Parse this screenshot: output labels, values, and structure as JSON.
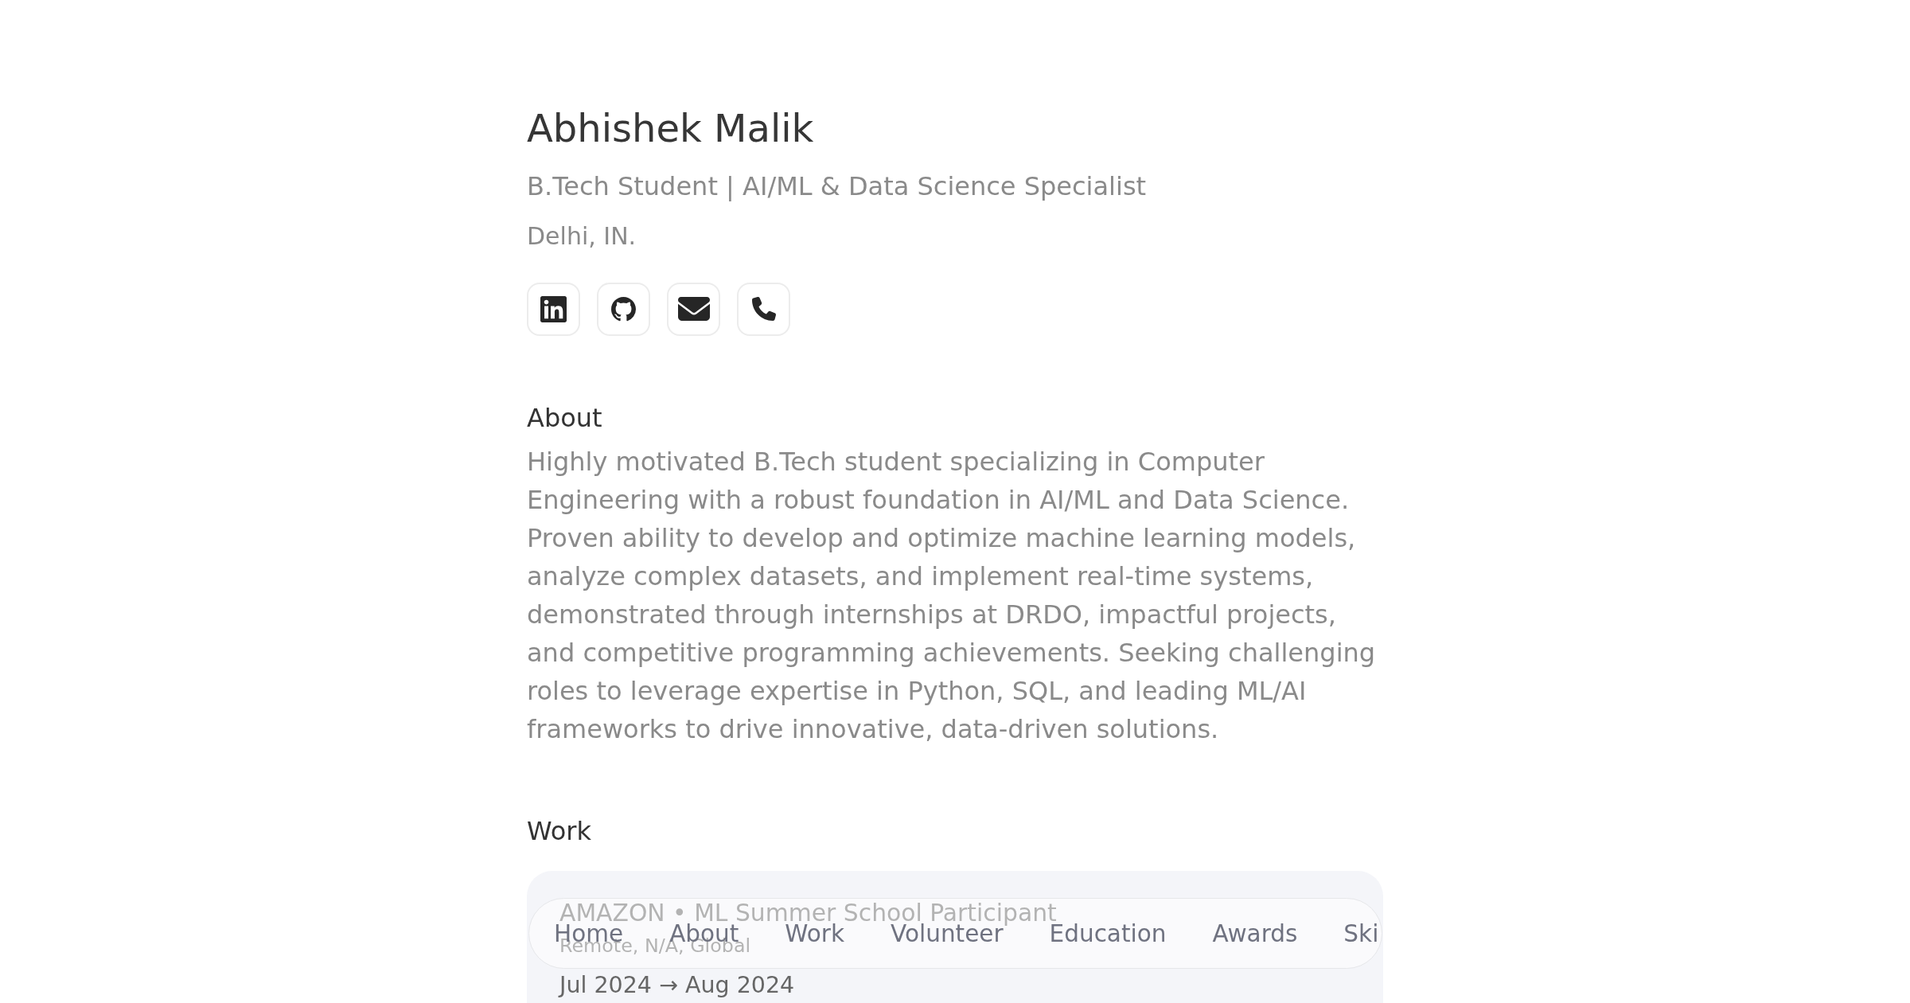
{
  "profile": {
    "name": "Abhishek Malik",
    "headline": "B.Tech Student | AI/ML & Data Science Specialist",
    "location": "Delhi, IN."
  },
  "social_links": [
    {
      "kind": "linkedin"
    },
    {
      "kind": "github"
    },
    {
      "kind": "email"
    },
    {
      "kind": "phone"
    }
  ],
  "about": {
    "heading": "About",
    "text": "Highly motivated B.Tech student specializing in Computer Engineering with a robust foundation in AI/ML and Data Science. Proven ability to develop and optimize machine learning models, analyze complex datasets, and implement real-time systems, demonstrated through internships at DRDO, impactful projects, and competitive programming achievements. Seeking challenging roles to leverage expertise in Python, SQL, and leading ML/AI frameworks to drive innovative, data-driven solutions."
  },
  "work": {
    "heading": "Work",
    "entries": [
      {
        "title": "AMAZON • ML Summer School Participant",
        "location": "Remote, N/A, Global",
        "dates": "Jul 2024 → Aug 2024"
      }
    ]
  },
  "nav": {
    "items": [
      "Home",
      "About",
      "Work",
      "Volunteer",
      "Education",
      "Awards",
      "Ski"
    ]
  }
}
